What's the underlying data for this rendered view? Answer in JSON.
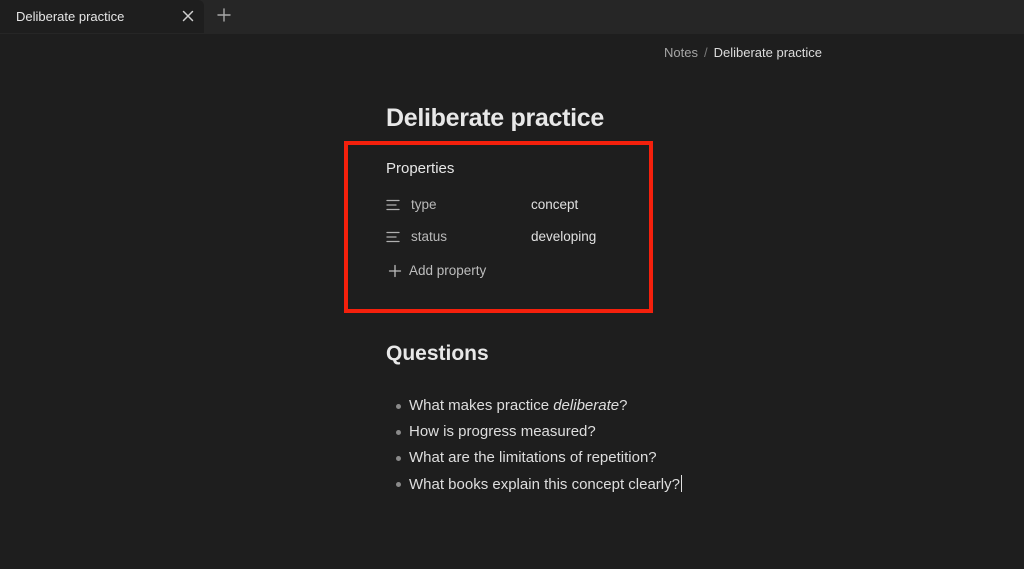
{
  "tab": {
    "title": "Deliberate practice"
  },
  "icons": {
    "close": "close-icon",
    "new_tab": "plus-icon",
    "property": "text-lines-icon",
    "add": "plus-icon"
  },
  "breadcrumb": {
    "parent": "Notes",
    "separator": "/",
    "current": "Deliberate practice"
  },
  "note": {
    "title": "Deliberate practice",
    "properties": {
      "heading": "Properties",
      "items": [
        {
          "key": "type",
          "value": "concept"
        },
        {
          "key": "status",
          "value": "developing"
        }
      ],
      "add_label": "Add property"
    },
    "questions": {
      "heading": "Questions",
      "items": [
        {
          "before": "What makes practice ",
          "emphasis": "deliberate",
          "after": "?"
        },
        {
          "before": "How is progress measured?"
        },
        {
          "before": "What are the limitations of repetition?"
        },
        {
          "before": "What books explain this concept clearly?"
        }
      ]
    }
  },
  "colors": {
    "background": "#1e1e1e",
    "tabbar": "#262626",
    "highlight": "#f4200c"
  }
}
